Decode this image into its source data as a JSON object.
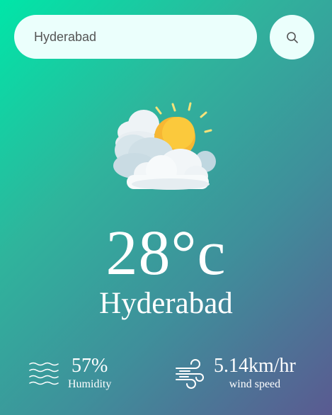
{
  "search": {
    "value": "Hyderabad",
    "button_icon": "search-icon"
  },
  "weather": {
    "icon": "partly-cloudy-icon",
    "temperature": "28°c",
    "city": "Hyderabad"
  },
  "details": {
    "humidity": {
      "value": "57%",
      "label": "Humidity",
      "icon": "humidity-waves-icon"
    },
    "wind": {
      "value": "5.14km/hr",
      "label": "wind speed",
      "icon": "wind-icon"
    }
  }
}
